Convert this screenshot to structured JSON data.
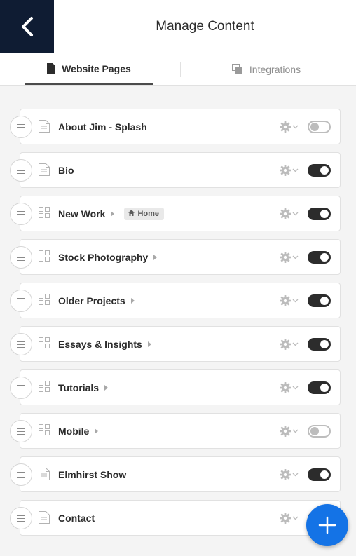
{
  "header": {
    "title": "Manage Content",
    "back_icon": "chevron-left-icon"
  },
  "tabs": [
    {
      "label": "Website Pages",
      "icon": "page-icon",
      "active": true
    },
    {
      "label": "Integrations",
      "icon": "stack-icon",
      "active": false
    }
  ],
  "pages": [
    {
      "label": "About Jim - Splash",
      "type": "page",
      "enabled": false,
      "has_children": false
    },
    {
      "label": "Bio",
      "type": "page",
      "enabled": true,
      "has_children": false
    },
    {
      "label": "New Work",
      "type": "gallery",
      "enabled": true,
      "has_children": true,
      "badge": "Home"
    },
    {
      "label": "Stock Photography",
      "type": "gallery",
      "enabled": true,
      "has_children": true
    },
    {
      "label": "Older Projects",
      "type": "gallery",
      "enabled": true,
      "has_children": true
    },
    {
      "label": "Essays & Insights",
      "type": "gallery",
      "enabled": true,
      "has_children": true
    },
    {
      "label": "Tutorials",
      "type": "gallery",
      "enabled": true,
      "has_children": true
    },
    {
      "label": "Mobile",
      "type": "gallery",
      "enabled": false,
      "has_children": true
    },
    {
      "label": "Elmhirst Show",
      "type": "page",
      "enabled": true,
      "has_children": false
    },
    {
      "label": "Contact",
      "type": "page",
      "enabled": true,
      "has_children": false
    }
  ],
  "fab": {
    "icon": "plus-icon"
  },
  "colors": {
    "back_bg": "#0f1c33",
    "fab_bg": "#1473e6",
    "toggle_on": "#2c2c2c",
    "toggle_off": "#bdbdbd"
  }
}
